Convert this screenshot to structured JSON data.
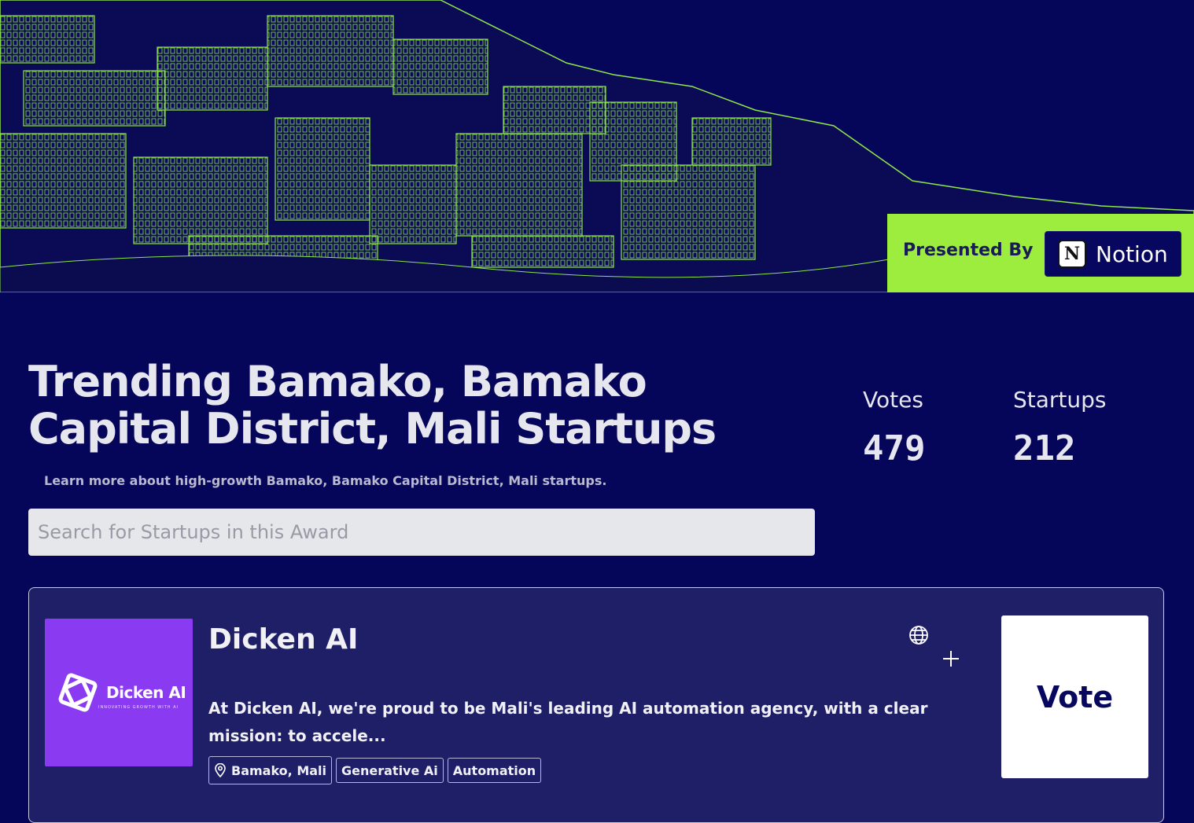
{
  "sponsor": {
    "presented_label": "Presented By",
    "name": "Notion",
    "icon_letter": "N"
  },
  "header": {
    "title": "Trending Bamako, Bamako Capital District, Mali Startups",
    "subtitle": "Learn more about high-growth Bamako, Bamako Capital District, Mali startups."
  },
  "stats": {
    "votes_label": "Votes",
    "votes_value": "479",
    "startups_label": "Startups",
    "startups_value": "212"
  },
  "search": {
    "placeholder": "Search for Startups in this Award",
    "value": ""
  },
  "startups": [
    {
      "name": "Dicken AI",
      "logo_text": "Dicken AI",
      "logo_tagline": "INNOVATING GROWTH WITH AI",
      "description": "At Dicken AI, we're proud to be Mali's leading AI automation agency, with a clear mission: to accele...",
      "location": "Bamako, Mali",
      "tags": [
        "Generative Ai",
        "Automation"
      ],
      "vote_label": "Vote"
    }
  ],
  "colors": {
    "background": "#05055a",
    "accent_green": "#9ded3f",
    "card_bg": "#1f1f68",
    "logo_purple": "#8a3bf2"
  },
  "icons": [
    "notion-icon",
    "globe-icon",
    "plus-icon",
    "location-pin-icon",
    "dicken-logo-icon"
  ]
}
